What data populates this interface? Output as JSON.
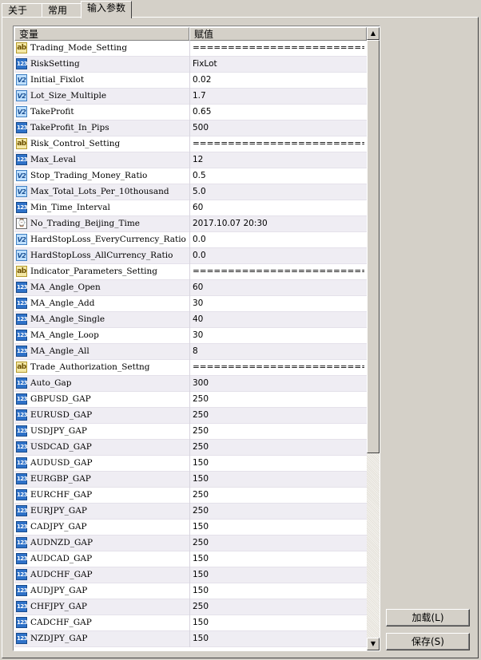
{
  "tabs": [
    {
      "label": "关于",
      "active": false
    },
    {
      "label": "常用",
      "active": false
    },
    {
      "label": "输入参数",
      "active": true
    }
  ],
  "table": {
    "columns": [
      "变量",
      "赋值"
    ],
    "rows": [
      {
        "type": "string",
        "icon": "ab",
        "name": "Trading_Mode_Setting",
        "value": "============================"
      },
      {
        "type": "integer",
        "icon": "123",
        "name": "RiskSetting",
        "value": "FixLot"
      },
      {
        "type": "double",
        "icon": "V2",
        "name": "Initial_Fixlot",
        "value": "0.02"
      },
      {
        "type": "double",
        "icon": "V2",
        "name": "Lot_Size_Multiple",
        "value": "1.7"
      },
      {
        "type": "double",
        "icon": "V2",
        "name": "TakeProfit",
        "value": "0.65"
      },
      {
        "type": "integer",
        "icon": "123",
        "name": "TakeProfit_In_Pips",
        "value": "500"
      },
      {
        "type": "string",
        "icon": "ab",
        "name": "Risk_Control_Setting",
        "value": "============================"
      },
      {
        "type": "integer",
        "icon": "123",
        "name": "Max_Leval",
        "value": "12"
      },
      {
        "type": "double",
        "icon": "V2",
        "name": "Stop_Trading_Money_Ratio",
        "value": "0.5"
      },
      {
        "type": "double",
        "icon": "V2",
        "name": "Max_Total_Lots_Per_10thousand",
        "value": "5.0"
      },
      {
        "type": "integer",
        "icon": "123",
        "name": "Min_Time_Interval",
        "value": "60"
      },
      {
        "type": "datetime",
        "icon": "⌚",
        "name": "No_Trading_Beijing_Time",
        "value": "2017.10.07 20:30"
      },
      {
        "type": "double",
        "icon": "V2",
        "name": "HardStopLoss_EveryCurrency_Ratio",
        "value": "0.0"
      },
      {
        "type": "double",
        "icon": "V2",
        "name": "HardStopLoss_AllCurrency_Ratio",
        "value": "0.0"
      },
      {
        "type": "string",
        "icon": "ab",
        "name": "Indicator_Parameters_Setting",
        "value": "============================"
      },
      {
        "type": "integer",
        "icon": "123",
        "name": "MA_Angle_Open",
        "value": "60"
      },
      {
        "type": "integer",
        "icon": "123",
        "name": "MA_Angle_Add",
        "value": "30"
      },
      {
        "type": "integer",
        "icon": "123",
        "name": "MA_Angle_Single",
        "value": "40"
      },
      {
        "type": "integer",
        "icon": "123",
        "name": "MA_Angle_Loop",
        "value": "30"
      },
      {
        "type": "integer",
        "icon": "123",
        "name": "MA_Angle_All",
        "value": "8"
      },
      {
        "type": "string",
        "icon": "ab",
        "name": "Trade_Authorization_Settng",
        "value": "============================"
      },
      {
        "type": "integer",
        "icon": "123",
        "name": "Auto_Gap",
        "value": "300"
      },
      {
        "type": "integer",
        "icon": "123",
        "name": "GBPUSD_GAP",
        "value": "250"
      },
      {
        "type": "integer",
        "icon": "123",
        "name": "EURUSD_GAP",
        "value": "250"
      },
      {
        "type": "integer",
        "icon": "123",
        "name": "USDJPY_GAP",
        "value": "250"
      },
      {
        "type": "integer",
        "icon": "123",
        "name": "USDCAD_GAP",
        "value": "250"
      },
      {
        "type": "integer",
        "icon": "123",
        "name": "AUDUSD_GAP",
        "value": "150"
      },
      {
        "type": "integer",
        "icon": "123",
        "name": "EURGBP_GAP",
        "value": "150"
      },
      {
        "type": "integer",
        "icon": "123",
        "name": "EURCHF_GAP",
        "value": "250"
      },
      {
        "type": "integer",
        "icon": "123",
        "name": "EURJPY_GAP",
        "value": "250"
      },
      {
        "type": "integer",
        "icon": "123",
        "name": "CADJPY_GAP",
        "value": "150"
      },
      {
        "type": "integer",
        "icon": "123",
        "name": "AUDNZD_GAP",
        "value": "250"
      },
      {
        "type": "integer",
        "icon": "123",
        "name": "AUDCAD_GAP",
        "value": "150"
      },
      {
        "type": "integer",
        "icon": "123",
        "name": "AUDCHF_GAP",
        "value": "150"
      },
      {
        "type": "integer",
        "icon": "123",
        "name": "AUDJPY_GAP",
        "value": "150"
      },
      {
        "type": "integer",
        "icon": "123",
        "name": "CHFJPY_GAP",
        "value": "250"
      },
      {
        "type": "integer",
        "icon": "123",
        "name": "CADCHF_GAP",
        "value": "150"
      },
      {
        "type": "integer",
        "icon": "123",
        "name": "NZDJPY_GAP",
        "value": "150"
      }
    ]
  },
  "scrollbar": {
    "up_glyph": "▲",
    "down_glyph": "▼"
  },
  "buttons": {
    "load": "加载(L)",
    "save": "保存(S)"
  }
}
